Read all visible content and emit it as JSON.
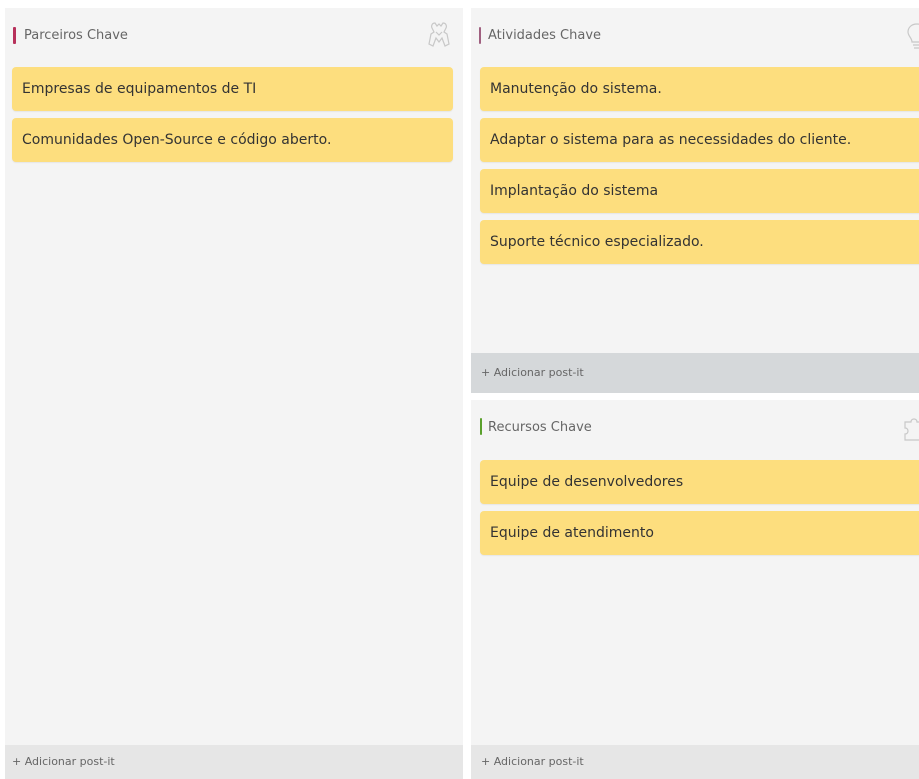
{
  "colors": {
    "background": "#ffffff",
    "panel": "#f4f4f4",
    "postit": "#fdde7e",
    "add_bar": "#d5d8da",
    "accent_parceiros": "#b7315b",
    "accent_atividades": "#a06080",
    "accent_recursos": "#5aa02c"
  },
  "parceiros": {
    "title": "Parceiros Chave",
    "icon": "handshake-outline-icon",
    "notes": [
      "Empresas de equipamentos de TI",
      "Comunidades Open-Source e código aberto."
    ],
    "add_label": "+ Adicionar post-it"
  },
  "atividades": {
    "title": "Atividades Chave",
    "icon": "lightbulb-outline-icon",
    "notes": [
      "Manutenção do sistema.",
      "Adaptar o sistema para as necessidades do cliente.",
      "Implantação do sistema",
      "Suporte técnico especializado."
    ],
    "add_label": "+ Adicionar post-it"
  },
  "recursos": {
    "title": "Recursos Chave",
    "icon": "puzzle-outline-icon",
    "notes": [
      "Equipe de desenvolvedores",
      "Equipe de atendimento"
    ],
    "add_label": "+ Adicionar post-it"
  }
}
